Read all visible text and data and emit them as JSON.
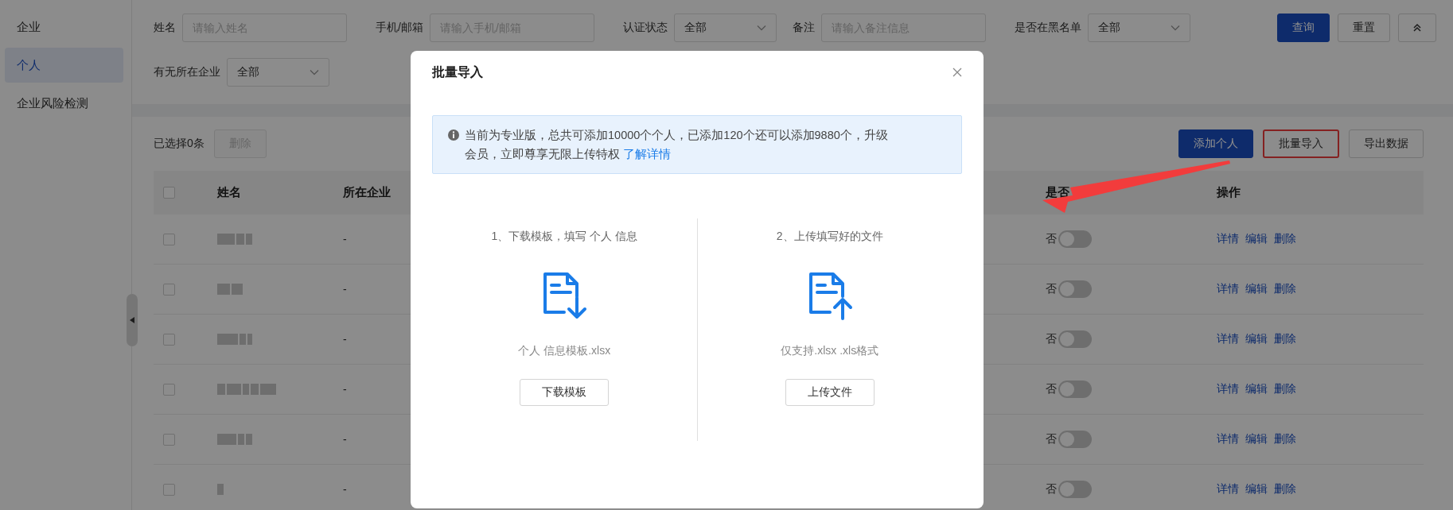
{
  "sidebar": {
    "items": [
      {
        "label": "企业",
        "selected": false
      },
      {
        "label": "个人",
        "selected": true
      },
      {
        "label": "企业风险检测",
        "selected": false
      }
    ]
  },
  "filters": {
    "fields": [
      {
        "kind": "input",
        "label": "姓名",
        "placeholder": "请输入姓名"
      },
      {
        "kind": "input",
        "label": "手机/邮箱",
        "placeholder": "请输入手机/邮箱"
      },
      {
        "kind": "select",
        "label": "认证状态",
        "value": "全部"
      },
      {
        "kind": "input",
        "label": "备注",
        "placeholder": "请输入备注信息"
      },
      {
        "kind": "select",
        "label": "是否在黑名单",
        "value": "全部"
      },
      {
        "kind": "select",
        "label": "有无所在企业",
        "value": "全部"
      }
    ],
    "buttons": [
      {
        "kind": "primary",
        "label": "查询"
      },
      {
        "kind": "default",
        "label": "重置"
      }
    ]
  },
  "toolbar": {
    "selected_count": "已选择0条",
    "delete_button": {
      "label": "删除",
      "disabled": true
    },
    "buttons": [
      {
        "label": "添加个人",
        "kind": "primary",
        "highlighted": false
      },
      {
        "label": "批量导入",
        "kind": "default",
        "highlighted": true
      },
      {
        "label": "导出数据",
        "kind": "default",
        "highlighted": false
      }
    ]
  },
  "table": {
    "header_checked": false,
    "columns": [
      "姓名",
      "所在企业",
      "是否",
      "操作"
    ],
    "rows": [
      {
        "checked": false,
        "company": "-",
        "blacklist_label": "否",
        "blacklisted": false,
        "actions": [
          "详情",
          "编辑",
          "删除"
        ]
      },
      {
        "checked": false,
        "company": "-",
        "blacklist_label": "否",
        "blacklisted": false,
        "actions": [
          "详情",
          "编辑",
          "删除"
        ]
      },
      {
        "checked": false,
        "company": "-",
        "blacklist_label": "否",
        "blacklisted": false,
        "actions": [
          "详情",
          "编辑",
          "删除"
        ]
      },
      {
        "checked": false,
        "company": "-",
        "blacklist_label": "否",
        "blacklisted": false,
        "actions": [
          "详情",
          "编辑",
          "删除"
        ]
      },
      {
        "checked": false,
        "company": "-",
        "blacklist_label": "否",
        "blacklisted": false,
        "actions": [
          "详情",
          "编辑",
          "删除"
        ]
      },
      {
        "checked": false,
        "company": "-",
        "blacklist_label": "否",
        "blacklisted": false,
        "actions": [
          "详情",
          "编辑",
          "删除"
        ]
      }
    ]
  },
  "dialog": {
    "title": "批量导入",
    "notice": {
      "text": "当前为专业版，总共可添加10000个个人，已添加120个还可以添加9880个，升级会员，立即尊享无限上传特权",
      "link": "了解详情"
    },
    "steps": [
      {
        "kind": "download",
        "title": "1、下载模板，填写 个人 信息",
        "note": "个人 信息模板.xlsx",
        "button": "下载模板"
      },
      {
        "kind": "upload",
        "title": "2、上传填写好的文件",
        "note": "仅支持.xlsx .xls格式",
        "button": "上传文件"
      }
    ]
  }
}
